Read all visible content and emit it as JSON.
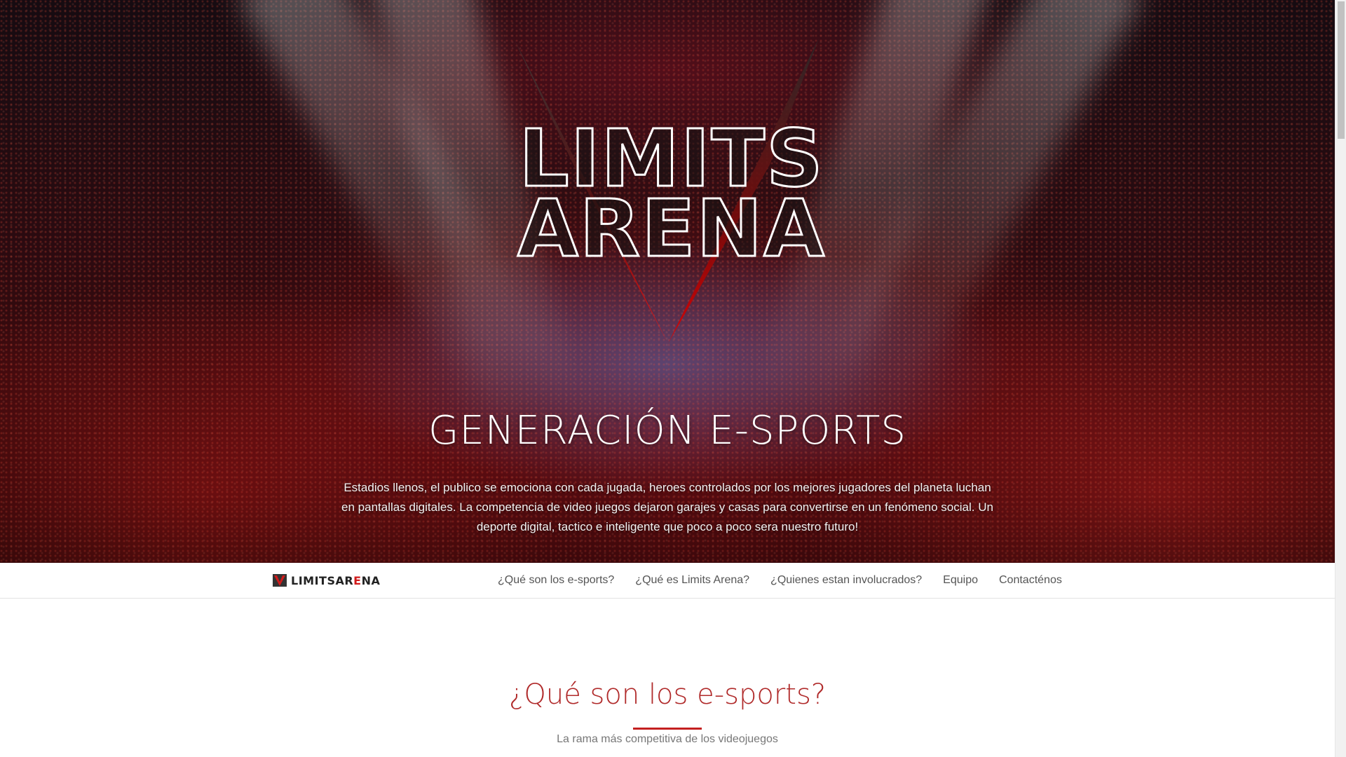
{
  "hero": {
    "logo_line1": "LIMITS",
    "logo_line2": "ARENA",
    "title": "GENERACIÓN E-SPORTS",
    "description": "Estadios llenos, el publico se emociona con cada jugada, heroes controlados por los mejores jugadores del planeta luchan en pantallas digitales. La competencia de video juegos dejaron garajes y casas para convertirse en un fenómeno social. Un deporte digital, tactico e inteligente que poco a poco sera nuestro futuro!"
  },
  "navbar": {
    "brand_part1": "LIMITS",
    "brand_part2_a": "AR",
    "brand_part2_b": "E",
    "brand_part2_c": "NA",
    "links": [
      "¿Qué son los e-sports?",
      "¿Qué es Limits Arena?",
      "¿Quienes estan involucrados?",
      "Equipo",
      "Contacténos"
    ]
  },
  "section": {
    "title": "¿Qué son los e-sports?",
    "subtitle": "La rama más competitiva de los videojuegos"
  },
  "colors": {
    "accent": "#c42020",
    "section_title": "#b02a2a",
    "nav_text": "#555555"
  }
}
